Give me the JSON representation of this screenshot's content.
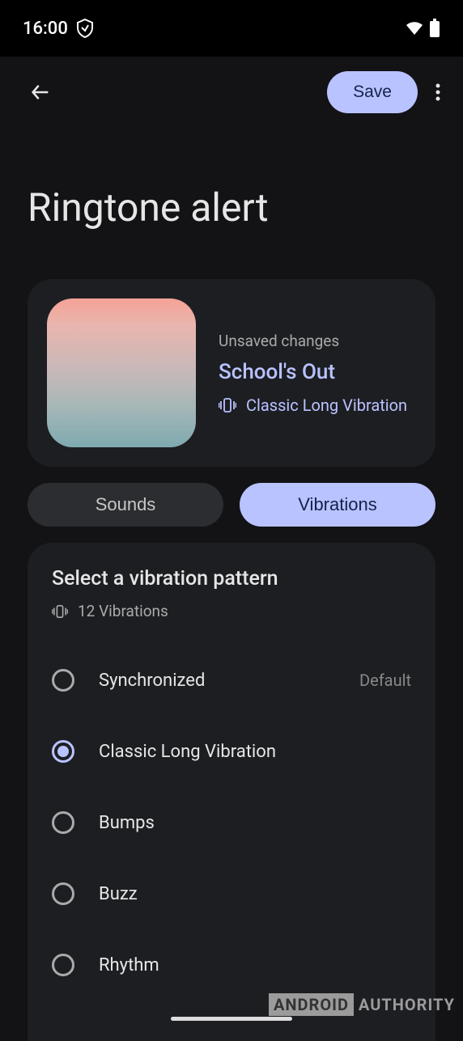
{
  "status": {
    "time": "16:00"
  },
  "topbar": {
    "save_label": "Save"
  },
  "page": {
    "title": "Ringtone alert"
  },
  "preview": {
    "unsaved_label": "Unsaved changes",
    "song_title": "School's Out",
    "vibration_name": "Classic Long Vibration"
  },
  "tabs": {
    "sounds_label": "Sounds",
    "vibrations_label": "Vibrations"
  },
  "patterns": {
    "header": "Select a vibration pattern",
    "count": "12 Vibrations",
    "default_label": "Default",
    "items": [
      {
        "label": "Synchronized",
        "selected": false,
        "default": true
      },
      {
        "label": "Classic Long Vibration",
        "selected": true,
        "default": false
      },
      {
        "label": "Bumps",
        "selected": false,
        "default": false
      },
      {
        "label": "Buzz",
        "selected": false,
        "default": false
      },
      {
        "label": "Rhythm",
        "selected": false,
        "default": false
      }
    ]
  },
  "watermark": {
    "boxed": "ANDROID",
    "plain": " AUTHORITY"
  }
}
